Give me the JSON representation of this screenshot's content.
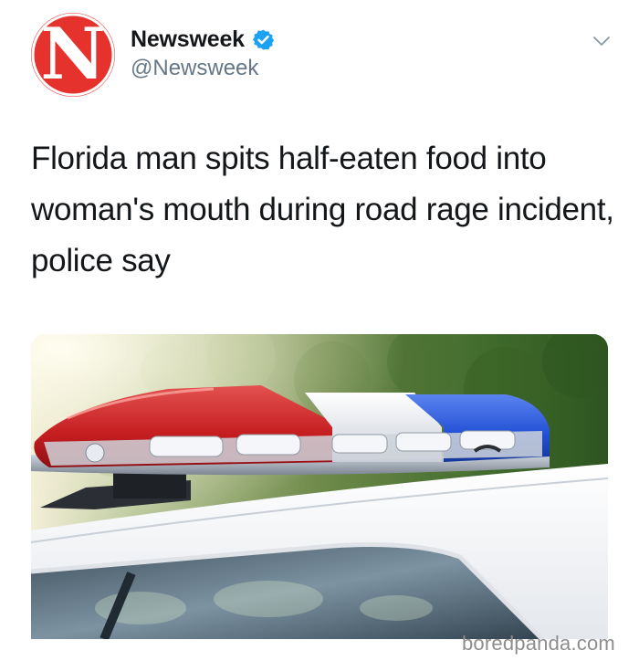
{
  "account": {
    "display_name": "Newsweek",
    "handle": "@Newsweek",
    "avatar_letter": "N",
    "avatar_color": "#e5322d",
    "verified": true,
    "verified_icon": "verified-badge-icon",
    "verified_color": "#1da1f2"
  },
  "menu": {
    "icon": "chevron-down-icon"
  },
  "tweet": {
    "text": "Florida man spits half-eaten food into woman's mouth during road rage incident, police say"
  },
  "media": {
    "subject": "police-light-bar-photo",
    "light_colors": [
      "#d8282a",
      "#e9ecf2",
      "#2456d8"
    ]
  },
  "watermark": {
    "text": "boredpanda.com"
  }
}
